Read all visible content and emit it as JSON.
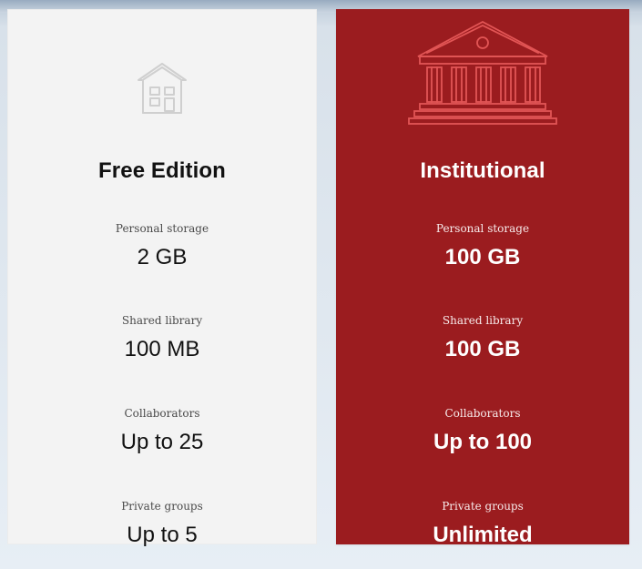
{
  "plans": [
    {
      "title": "Free Edition",
      "icon": "house-icon",
      "colors": {
        "background": "#f3f3f3",
        "text": "#111111",
        "icon": "#cfcfcf"
      },
      "stats": [
        {
          "label": "Personal storage",
          "value": "2 GB"
        },
        {
          "label": "Shared library",
          "value": "100 MB"
        },
        {
          "label": "Collaborators",
          "value": "Up to 25"
        },
        {
          "label": "Private groups",
          "value": "Up to 5"
        }
      ]
    },
    {
      "title": "Institutional",
      "icon": "institution-icon",
      "colors": {
        "background": "#9b1c1f",
        "text": "#ffffff",
        "icon": "#e25555"
      },
      "stats": [
        {
          "label": "Personal storage",
          "value": "100 GB"
        },
        {
          "label": "Shared library",
          "value": "100 GB"
        },
        {
          "label": "Collaborators",
          "value": "Up to 100"
        },
        {
          "label": "Private groups",
          "value": "Unlimited"
        }
      ]
    }
  ]
}
